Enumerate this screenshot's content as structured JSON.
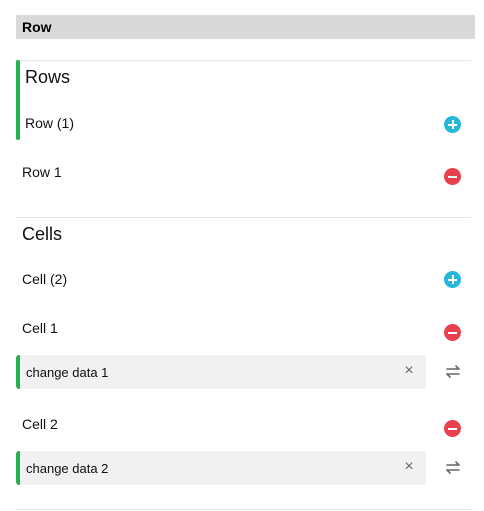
{
  "header": {
    "title": "Row"
  },
  "rows_section": {
    "title": "Rows",
    "count_label": "Row (1)",
    "items": [
      {
        "label": "Row 1"
      }
    ]
  },
  "cells_section": {
    "title": "Cells",
    "count_label": "Cell (2)",
    "items": [
      {
        "label": "Cell 1",
        "value": "change data 1"
      },
      {
        "label": "Cell 2",
        "value": "change data 2"
      }
    ]
  },
  "colors": {
    "accent": "#22b14c",
    "add": "#25b9d7",
    "remove": "#e8414d",
    "header_bg": "#d9d9d9",
    "field_bg": "#f1f1f1"
  },
  "icons": [
    "add-icon",
    "remove-icon",
    "clear-icon",
    "swap-icon"
  ]
}
